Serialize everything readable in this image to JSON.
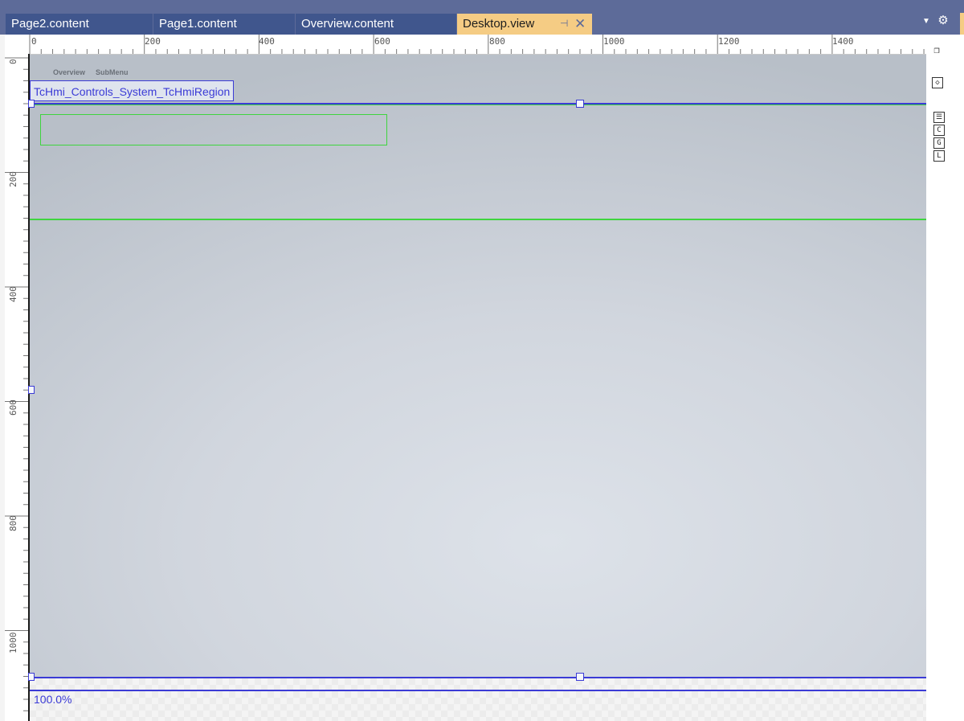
{
  "tabs": [
    {
      "label": "Page2.content",
      "active": false
    },
    {
      "label": "Page1.content",
      "active": false
    },
    {
      "label": "Overview.content",
      "active": false
    },
    {
      "label": "Desktop.view",
      "active": true
    }
  ],
  "tab_icons": {
    "pin": "pin-icon",
    "close": "close-icon",
    "dropdown": "chevron-down-icon",
    "settings": "gear-icon"
  },
  "rulers": {
    "horizontal": [
      "0",
      "200",
      "400",
      "600",
      "800",
      "1000",
      "1200",
      "1400"
    ],
    "vertical": [
      "0",
      "200",
      "400",
      "600",
      "800",
      "1000"
    ]
  },
  "canvas": {
    "menu_items": [
      "Overview",
      "SubMenu"
    ],
    "region_label": "TcHmi_Controls_System_TcHmiRegion",
    "zoom": "100.0%"
  },
  "side_tools": [
    "C",
    "G",
    "L"
  ],
  "colors": {
    "accent": "#f5cc84",
    "selection": "#3b3bd6",
    "guide": "#3fd43f",
    "tabstrip": "#5d6b99",
    "tab": "#40568d"
  }
}
